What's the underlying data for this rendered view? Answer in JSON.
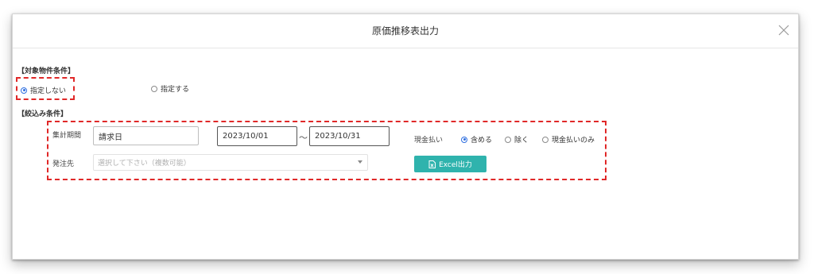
{
  "dialog": {
    "title": "原価推移表出力"
  },
  "target_section": {
    "label": "【対象物件条件】",
    "options": [
      {
        "label": "指定しない",
        "checked": true
      },
      {
        "label": "指定する",
        "checked": false
      }
    ]
  },
  "filter_section": {
    "label": "【絞込み条件】",
    "period_label": "集計期間",
    "period_type_value": "請求日",
    "date_from": "2023/10/01",
    "date_separator": "～",
    "date_to": "2023/10/31",
    "cash_label": "現金払い",
    "cash_options": [
      {
        "label": "含める",
        "checked": true
      },
      {
        "label": "除く",
        "checked": false
      },
      {
        "label": "現金払いのみ",
        "checked": false
      }
    ],
    "vendor_label": "発注先",
    "vendor_placeholder": "選択して下さい（複数可能）",
    "excel_button_label": "Excel出力"
  },
  "colors": {
    "accent_button": "#2fb3ad",
    "highlight_dash": "#e02828",
    "radio_checked": "#2f6fe0"
  }
}
